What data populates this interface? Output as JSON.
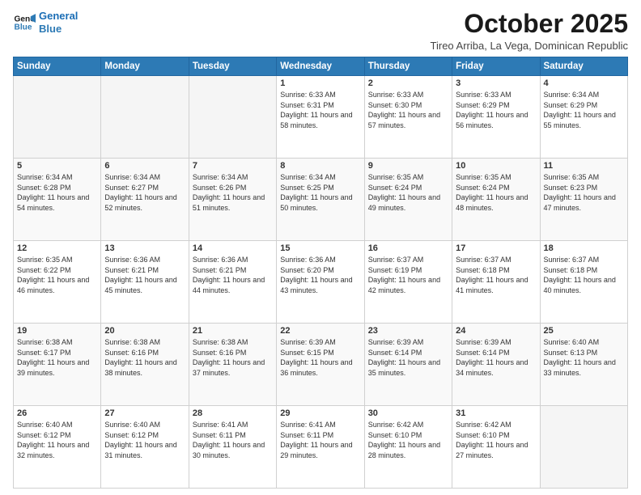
{
  "header": {
    "logo_line1": "General",
    "logo_line2": "Blue",
    "month_year": "October 2025",
    "location": "Tireo Arriba, La Vega, Dominican Republic"
  },
  "weekdays": [
    "Sunday",
    "Monday",
    "Tuesday",
    "Wednesday",
    "Thursday",
    "Friday",
    "Saturday"
  ],
  "weeks": [
    [
      {
        "day": "",
        "empty": true
      },
      {
        "day": "",
        "empty": true
      },
      {
        "day": "",
        "empty": true
      },
      {
        "day": "1",
        "sunrise": "6:33 AM",
        "sunset": "6:31 PM",
        "daylight": "11 hours and 58 minutes."
      },
      {
        "day": "2",
        "sunrise": "6:33 AM",
        "sunset": "6:30 PM",
        "daylight": "11 hours and 57 minutes."
      },
      {
        "day": "3",
        "sunrise": "6:33 AM",
        "sunset": "6:29 PM",
        "daylight": "11 hours and 56 minutes."
      },
      {
        "day": "4",
        "sunrise": "6:34 AM",
        "sunset": "6:29 PM",
        "daylight": "11 hours and 55 minutes."
      }
    ],
    [
      {
        "day": "5",
        "sunrise": "6:34 AM",
        "sunset": "6:28 PM",
        "daylight": "11 hours and 54 minutes."
      },
      {
        "day": "6",
        "sunrise": "6:34 AM",
        "sunset": "6:27 PM",
        "daylight": "11 hours and 52 minutes."
      },
      {
        "day": "7",
        "sunrise": "6:34 AM",
        "sunset": "6:26 PM",
        "daylight": "11 hours and 51 minutes."
      },
      {
        "day": "8",
        "sunrise": "6:34 AM",
        "sunset": "6:25 PM",
        "daylight": "11 hours and 50 minutes."
      },
      {
        "day": "9",
        "sunrise": "6:35 AM",
        "sunset": "6:24 PM",
        "daylight": "11 hours and 49 minutes."
      },
      {
        "day": "10",
        "sunrise": "6:35 AM",
        "sunset": "6:24 PM",
        "daylight": "11 hours and 48 minutes."
      },
      {
        "day": "11",
        "sunrise": "6:35 AM",
        "sunset": "6:23 PM",
        "daylight": "11 hours and 47 minutes."
      }
    ],
    [
      {
        "day": "12",
        "sunrise": "6:35 AM",
        "sunset": "6:22 PM",
        "daylight": "11 hours and 46 minutes."
      },
      {
        "day": "13",
        "sunrise": "6:36 AM",
        "sunset": "6:21 PM",
        "daylight": "11 hours and 45 minutes."
      },
      {
        "day": "14",
        "sunrise": "6:36 AM",
        "sunset": "6:21 PM",
        "daylight": "11 hours and 44 minutes."
      },
      {
        "day": "15",
        "sunrise": "6:36 AM",
        "sunset": "6:20 PM",
        "daylight": "11 hours and 43 minutes."
      },
      {
        "day": "16",
        "sunrise": "6:37 AM",
        "sunset": "6:19 PM",
        "daylight": "11 hours and 42 minutes."
      },
      {
        "day": "17",
        "sunrise": "6:37 AM",
        "sunset": "6:18 PM",
        "daylight": "11 hours and 41 minutes."
      },
      {
        "day": "18",
        "sunrise": "6:37 AM",
        "sunset": "6:18 PM",
        "daylight": "11 hours and 40 minutes."
      }
    ],
    [
      {
        "day": "19",
        "sunrise": "6:38 AM",
        "sunset": "6:17 PM",
        "daylight": "11 hours and 39 minutes."
      },
      {
        "day": "20",
        "sunrise": "6:38 AM",
        "sunset": "6:16 PM",
        "daylight": "11 hours and 38 minutes."
      },
      {
        "day": "21",
        "sunrise": "6:38 AM",
        "sunset": "6:16 PM",
        "daylight": "11 hours and 37 minutes."
      },
      {
        "day": "22",
        "sunrise": "6:39 AM",
        "sunset": "6:15 PM",
        "daylight": "11 hours and 36 minutes."
      },
      {
        "day": "23",
        "sunrise": "6:39 AM",
        "sunset": "6:14 PM",
        "daylight": "11 hours and 35 minutes."
      },
      {
        "day": "24",
        "sunrise": "6:39 AM",
        "sunset": "6:14 PM",
        "daylight": "11 hours and 34 minutes."
      },
      {
        "day": "25",
        "sunrise": "6:40 AM",
        "sunset": "6:13 PM",
        "daylight": "11 hours and 33 minutes."
      }
    ],
    [
      {
        "day": "26",
        "sunrise": "6:40 AM",
        "sunset": "6:12 PM",
        "daylight": "11 hours and 32 minutes."
      },
      {
        "day": "27",
        "sunrise": "6:40 AM",
        "sunset": "6:12 PM",
        "daylight": "11 hours and 31 minutes."
      },
      {
        "day": "28",
        "sunrise": "6:41 AM",
        "sunset": "6:11 PM",
        "daylight": "11 hours and 30 minutes."
      },
      {
        "day": "29",
        "sunrise": "6:41 AM",
        "sunset": "6:11 PM",
        "daylight": "11 hours and 29 minutes."
      },
      {
        "day": "30",
        "sunrise": "6:42 AM",
        "sunset": "6:10 PM",
        "daylight": "11 hours and 28 minutes."
      },
      {
        "day": "31",
        "sunrise": "6:42 AM",
        "sunset": "6:10 PM",
        "daylight": "11 hours and 27 minutes."
      },
      {
        "day": "",
        "empty": true
      }
    ]
  ]
}
